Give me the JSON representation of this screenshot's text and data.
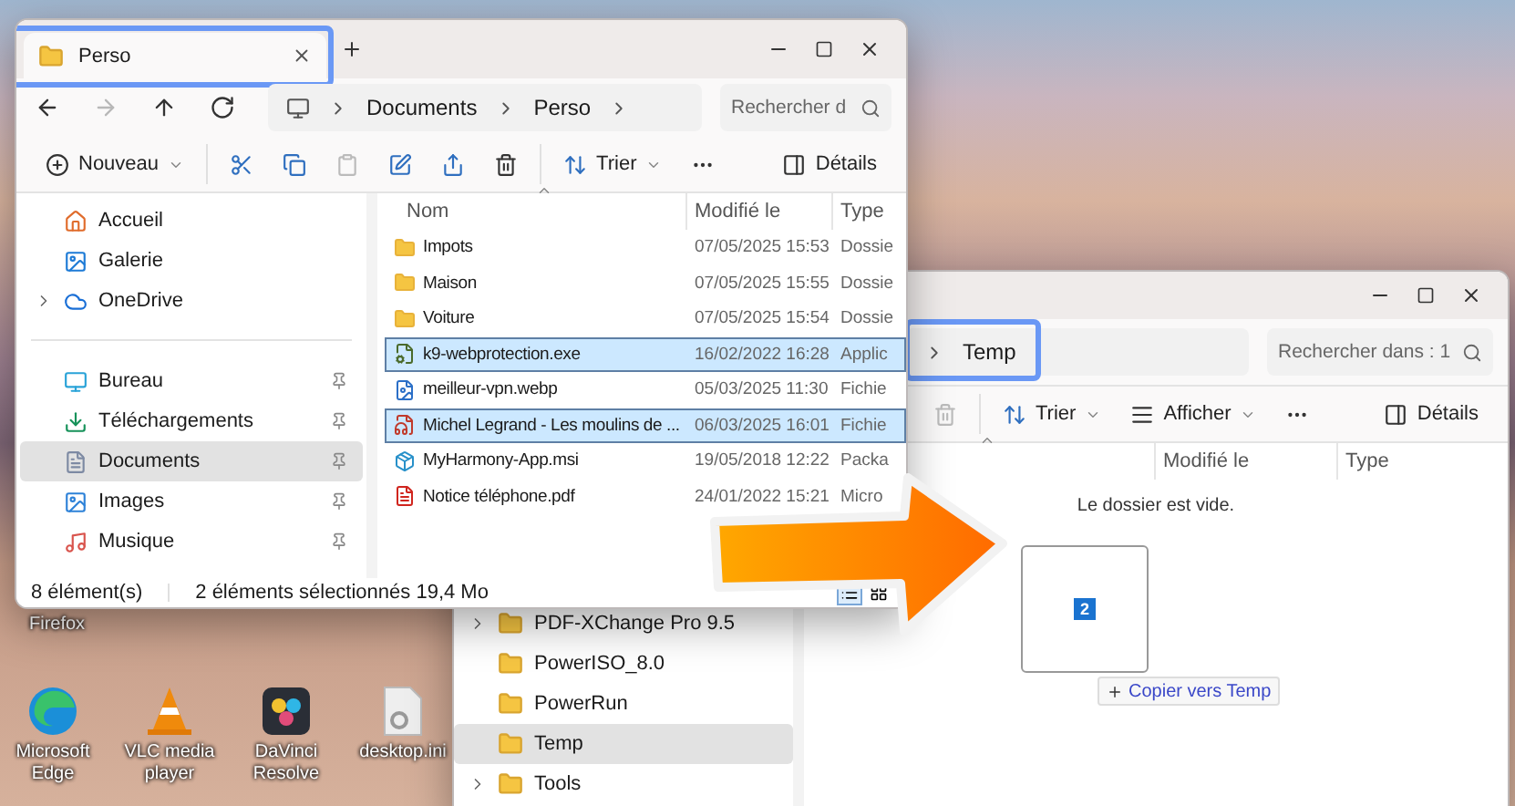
{
  "desktop": {
    "icons": [
      {
        "kind": "firefox",
        "label": "Firefox"
      },
      {
        "kind": "edge",
        "label": "Microsoft Edge"
      },
      {
        "kind": "vlc",
        "label": "VLC media player"
      },
      {
        "kind": "davinci",
        "label": "DaVinci Resolve"
      },
      {
        "kind": "ini",
        "label": "desktop.ini"
      }
    ]
  },
  "back_window": {
    "address": {
      "crumbs": [
        "Temp"
      ],
      "highlighted": true
    },
    "search": {
      "placeholder": "Rechercher dans : 1"
    },
    "toolbar": {
      "groups": [
        [
          {
            "kind": "delete",
            "disabled": true
          }
        ],
        [
          {
            "kind": "sort",
            "label": "Trier",
            "dropdown": true
          },
          {
            "kind": "view",
            "label": "Afficher",
            "dropdown": true
          },
          {
            "kind": "more",
            "disabled": false
          }
        ]
      ],
      "details": "Détails"
    },
    "columns": [
      {
        "sorted": true
      },
      {
        "label": "Modifié le",
        "sorted": false
      },
      {
        "label": "Type",
        "sorted": false
      }
    ],
    "empty_message": "Le dossier est vide.",
    "nav_items": [
      {
        "label": "PDF-XChange Pro 9.5",
        "expandable": true,
        "selected": false
      },
      {
        "label": "PowerISO_8.0",
        "expandable": false,
        "selected": false
      },
      {
        "label": "PowerRun",
        "expandable": false,
        "selected": false
      },
      {
        "label": "Temp",
        "expandable": false,
        "selected": true
      },
      {
        "label": "Tools",
        "expandable": true,
        "selected": false
      }
    ]
  },
  "front_window": {
    "tabs": [
      {
        "label": "Perso",
        "selected": true,
        "highlighted": true
      }
    ],
    "address": {
      "crumbs": [
        "Documents",
        "Perso"
      ]
    },
    "search": {
      "placeholder": "Rechercher d"
    },
    "nav_buttons": [
      {
        "kind": "back",
        "disabled": false
      },
      {
        "kind": "forward",
        "disabled": true
      },
      {
        "kind": "up",
        "disabled": false
      },
      {
        "kind": "refresh",
        "disabled": false
      }
    ],
    "toolbar": {
      "groups": [
        [
          {
            "kind": "new",
            "label": "Nouveau",
            "dropdown": true
          }
        ],
        [
          {
            "kind": "cut",
            "disabled": false
          },
          {
            "kind": "copy",
            "disabled": false
          },
          {
            "kind": "paste",
            "disabled": true
          },
          {
            "kind": "rename",
            "disabled": false
          },
          {
            "kind": "share",
            "disabled": false
          },
          {
            "kind": "delete",
            "disabled": false
          }
        ],
        [
          {
            "kind": "sort",
            "label": "Trier",
            "dropdown": true
          },
          {
            "kind": "more",
            "disabled": false
          }
        ]
      ],
      "details": "Détails"
    },
    "sidebar": [
      {
        "kind": "home",
        "label": "Accueil",
        "selected": false,
        "expandable": false,
        "pinned": false
      },
      {
        "kind": "gallery",
        "label": "Galerie",
        "selected": false,
        "expandable": false,
        "pinned": false
      },
      {
        "kind": "cloud",
        "label": "OneDrive",
        "selected": false,
        "expandable": true,
        "pinned": false
      },
      {
        "kind": "separator"
      },
      {
        "kind": "desktop",
        "label": "Bureau",
        "selected": false,
        "expandable": false,
        "pinned": true
      },
      {
        "kind": "download",
        "label": "Téléchargements",
        "selected": false,
        "expandable": false,
        "pinned": true
      },
      {
        "kind": "documents",
        "label": "Documents",
        "selected": true,
        "expandable": false,
        "pinned": true
      },
      {
        "kind": "images",
        "label": "Images",
        "selected": false,
        "expandable": false,
        "pinned": true
      },
      {
        "kind": "music",
        "label": "Musique",
        "selected": false,
        "expandable": false,
        "pinned": true
      }
    ],
    "columns": [
      {
        "label": "Nom",
        "sorted": true
      },
      {
        "label": "Modifié le",
        "sorted": false
      },
      {
        "label": "Type",
        "sorted": false
      }
    ],
    "files": [
      {
        "kind": "folder",
        "name": "Impots",
        "modified": "07/05/2025 15:53",
        "type": "Dossie",
        "selected": false
      },
      {
        "kind": "folder",
        "name": "Maison",
        "modified": "07/05/2025 15:55",
        "type": "Dossie",
        "selected": false
      },
      {
        "kind": "folder",
        "name": "Voiture",
        "modified": "07/05/2025 15:54",
        "type": "Dossie",
        "selected": false
      },
      {
        "kind": "exe",
        "name": "k9-webprotection.exe",
        "modified": "16/02/2022 16:28",
        "type": "Applic",
        "selected": true
      },
      {
        "kind": "image",
        "name": "meilleur-vpn.webp",
        "modified": "05/03/2025 11:30",
        "type": "Fichie",
        "selected": false
      },
      {
        "kind": "audio",
        "name": "Michel Legrand - Les moulins de ...",
        "modified": "06/03/2025 16:01",
        "type": "Fichie",
        "selected": true
      },
      {
        "kind": "installer",
        "name": "MyHarmony-App.msi",
        "modified": "19/05/2018 12:22",
        "type": "Packa",
        "selected": false
      },
      {
        "kind": "pdf",
        "name": "Notice téléphone.pdf",
        "modified": "24/01/2022 15:21",
        "type": "Micro",
        "selected": false
      }
    ],
    "status": {
      "count": "8 élément(s)",
      "selection": "2 éléments sélectionnés  19,4 Mo"
    },
    "views": [
      {
        "kind": "details",
        "selected": true
      },
      {
        "kind": "tiles",
        "selected": false
      }
    ]
  },
  "drag": {
    "count": "2",
    "tooltip": "Copier vers Temp"
  }
}
